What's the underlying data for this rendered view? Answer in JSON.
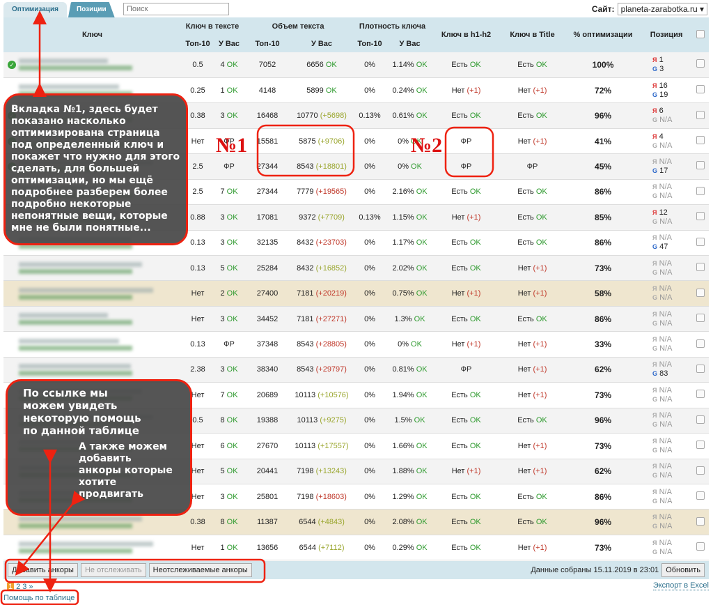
{
  "tabs": [
    "Оптимизация",
    "Позиции"
  ],
  "search": {
    "placeholder": "Поиск"
  },
  "site": {
    "label": "Сайт:",
    "value": "planeta-zarabotka.ru"
  },
  "headers": {
    "key": "Ключ",
    "key_in_text": "Ключ в тексте",
    "text_volume": "Объем текста",
    "density": "Плотность ключа",
    "top10": "Топ-10",
    "yours": "У Вас",
    "h1h2": "Ключ в h1-h2",
    "title": "Ключ в Title",
    "optim": "% оптимизации",
    "position": "Позиция"
  },
  "rows": [
    {
      "kt": "0.5",
      "ky": "4",
      "vt": "7052",
      "vy": "6656",
      "vd": "",
      "vc": "",
      "dt": "0%",
      "dy": "1.14%",
      "h": "Есть",
      "t": "Есть",
      "p": "100%",
      "ya": "1",
      "g": "3",
      "ok": true
    },
    {
      "kt": "0.25",
      "ky": "1",
      "vt": "4148",
      "vy": "5899",
      "vd": "",
      "vc": "",
      "dt": "0%",
      "dy": "0.24%",
      "h": "Нет",
      "t": "Нет",
      "p": "72%",
      "ya": "16",
      "g": "19"
    },
    {
      "kt": "0.38",
      "ky": "3",
      "vt": "16468",
      "vy": "10770",
      "vd": "(+5698)",
      "vc": "yel",
      "dt": "0.13%",
      "dy": "0.61%",
      "h": "Есть",
      "t": "Есть",
      "p": "96%",
      "ya": "6",
      "g": "N/A",
      "ok": true
    },
    {
      "kt": "Нет",
      "ky": "ФР",
      "vt": "15581",
      "vy": "5875",
      "vd": "(+9706)",
      "vc": "yel",
      "dt": "0%",
      "dy": "0%",
      "h": "ФР",
      "t": "Нет",
      "p": "41%",
      "ya": "4",
      "g": "N/A",
      "ok": true
    },
    {
      "kt": "2.5",
      "ky": "ФР",
      "vt": "27344",
      "vy": "8543",
      "vd": "(+18801)",
      "vc": "yel",
      "dt": "0%",
      "dy": "0%",
      "h": "ФР",
      "t": "ФР",
      "p": "45%",
      "ya": "N/A",
      "g": "17",
      "ok": true
    },
    {
      "kt": "2.5",
      "ky": "7",
      "vt": "27344",
      "vy": "7779",
      "vd": "(+19565)",
      "vc": "red",
      "dt": "0%",
      "dy": "2.16%",
      "h": "Есть",
      "t": "Есть",
      "p": "86%",
      "ya": "N/A",
      "g": "N/A"
    },
    {
      "kt": "0.88",
      "ky": "3",
      "vt": "17081",
      "vy": "9372",
      "vd": "(+7709)",
      "vc": "yel",
      "dt": "0.13%",
      "dy": "1.15%",
      "h": "Нет",
      "t": "Есть",
      "p": "85%",
      "ya": "12",
      "g": "N/A"
    },
    {
      "kt": "0.13",
      "ky": "3",
      "vt": "32135",
      "vy": "8432",
      "vd": "(+23703)",
      "vc": "red",
      "dt": "0%",
      "dy": "1.17%",
      "h": "Есть",
      "t": "Есть",
      "p": "86%",
      "ya": "N/A",
      "g": "47"
    },
    {
      "kt": "0.13",
      "ky": "5",
      "vt": "25284",
      "vy": "8432",
      "vd": "(+16852)",
      "vc": "yel",
      "dt": "0%",
      "dy": "2.02%",
      "h": "Есть",
      "t": "Нет",
      "p": "73%",
      "ya": "N/A",
      "g": "N/A"
    },
    {
      "kt": "Нет",
      "ky": "2",
      "vt": "27400",
      "vy": "7181",
      "vd": "(+20219)",
      "vc": "red",
      "dt": "0%",
      "dy": "0.75%",
      "h": "Нет",
      "t": "Нет",
      "p": "58%",
      "ya": "N/A",
      "g": "N/A",
      "hl": true
    },
    {
      "kt": "Нет",
      "ky": "3",
      "vt": "34452",
      "vy": "7181",
      "vd": "(+27271)",
      "vc": "red",
      "dt": "0%",
      "dy": "1.3%",
      "h": "Есть",
      "t": "Есть",
      "p": "86%",
      "ya": "N/A",
      "g": "N/A"
    },
    {
      "kt": "0.13",
      "ky": "ФР",
      "vt": "37348",
      "vy": "8543",
      "vd": "(+28805)",
      "vc": "red",
      "dt": "0%",
      "dy": "0%",
      "h": "Нет",
      "t": "Нет",
      "p": "33%",
      "ya": "N/A",
      "g": "N/A"
    },
    {
      "kt": "2.38",
      "ky": "3",
      "vt": "38340",
      "vy": "8543",
      "vd": "(+29797)",
      "vc": "red",
      "dt": "0%",
      "dy": "0.81%",
      "h": "ФР",
      "t": "Нет",
      "p": "62%",
      "ya": "N/A",
      "g": "83"
    },
    {
      "kt": "Нет",
      "ky": "7",
      "vt": "20689",
      "vy": "10113",
      "vd": "(+10576)",
      "vc": "yel",
      "dt": "0%",
      "dy": "1.94%",
      "h": "Есть",
      "t": "Нет",
      "p": "73%",
      "ya": "N/A",
      "g": "N/A"
    },
    {
      "kt": "0.5",
      "ky": "8",
      "vt": "19388",
      "vy": "10113",
      "vd": "(+9275)",
      "vc": "yel",
      "dt": "0%",
      "dy": "1.5%",
      "h": "Есть",
      "t": "Есть",
      "p": "96%",
      "ya": "N/A",
      "g": "N/A"
    },
    {
      "kt": "Нет",
      "ky": "6",
      "vt": "27670",
      "vy": "10113",
      "vd": "(+17557)",
      "vc": "yel",
      "dt": "0%",
      "dy": "1.66%",
      "h": "Есть",
      "t": "Нет",
      "p": "73%",
      "ya": "N/A",
      "g": "N/A"
    },
    {
      "kt": "Нет",
      "ky": "5",
      "vt": "20441",
      "vy": "7198",
      "vd": "(+13243)",
      "vc": "yel",
      "dt": "0%",
      "dy": "1.88%",
      "h": "Нет",
      "t": "Нет",
      "p": "62%",
      "ya": "N/A",
      "g": "N/A"
    },
    {
      "kt": "Нет",
      "ky": "3",
      "vt": "25801",
      "vy": "7198",
      "vd": "(+18603)",
      "vc": "red",
      "dt": "0%",
      "dy": "1.29%",
      "h": "Есть",
      "t": "Есть",
      "p": "86%",
      "ya": "N/A",
      "g": "N/A"
    },
    {
      "kt": "0.38",
      "ky": "8",
      "vt": "11387",
      "vy": "6544",
      "vd": "(+4843)",
      "vc": "yel",
      "dt": "0%",
      "dy": "2.08%",
      "h": "Есть",
      "t": "Есть",
      "p": "96%",
      "ya": "N/A",
      "g": "N/A",
      "hl": true
    },
    {
      "kt": "Нет",
      "ky": "1",
      "vt": "13656",
      "vy": "6544",
      "vd": "(+7112)",
      "vc": "yel",
      "dt": "0%",
      "dy": "0.29%",
      "h": "Есть",
      "t": "Нет",
      "p": "73%",
      "ya": "N/A",
      "g": "N/A"
    }
  ],
  "labels": {
    "ok": "OK",
    "plus1": "(+1)",
    "ya": "Я",
    "g": "G"
  },
  "toolbar": {
    "add": "Добавить анкоры",
    "untrack": "Не отслеживать",
    "untracked": "Неотслеживаемые анкоры",
    "collected": "Данные собраны 15.11.2019 в 23:01",
    "refresh": "Обновить"
  },
  "pager": [
    "1",
    "2",
    "3",
    "»"
  ],
  "export": "Экспорт в Excel",
  "help": "Помощь по таблице",
  "annotations": {
    "callout1": "Вкладка №1, здесь будет показано насколько оптимизирована страница под определенный ключ и покажет что нужно для этого сделать, для большей оптимизации, но мы ещё подробнее разберем более подробно некоторые непонятные вещи, которые мне не были понятные...",
    "callout2a": "По ссылке мы можем увидеть некоторую помощь по данной таблице",
    "callout2b": "А также можем добавить анкоры которые хотите продвигать",
    "n1": "№1",
    "n2": "№2"
  }
}
